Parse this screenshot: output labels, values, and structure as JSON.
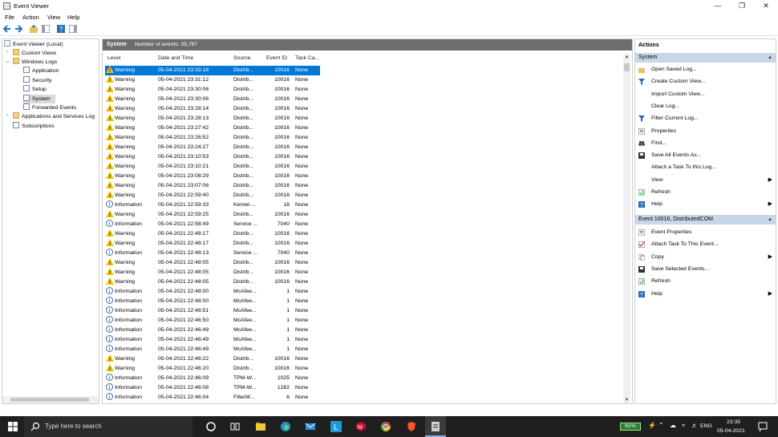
{
  "window": {
    "title": "Event Viewer"
  },
  "menu": [
    "File",
    "Action",
    "View",
    "Help"
  ],
  "tree": {
    "root": "Event Viewer (Local)",
    "custom_views": "Custom Views",
    "windows_logs": "Windows Logs",
    "logs": [
      "Application",
      "Security",
      "Setup",
      "System",
      "Forwarded Events"
    ],
    "apps_services": "Applications and Services Log",
    "subscriptions": "Subscriptions"
  },
  "center": {
    "header_title": "System",
    "header_count": "Number of events: 35,787",
    "columns": [
      "Level",
      "Date and Time",
      "Source",
      "Event ID",
      "Task Ca..."
    ],
    "rows": [
      {
        "level": "Warning",
        "date": "05-04-2021 23:33:18",
        "source": "Distrib...",
        "id": "10016",
        "task": "None",
        "selected": true
      },
      {
        "level": "Warning",
        "date": "05-04-2021 23:31:12",
        "source": "Distrib...",
        "id": "10016",
        "task": "None"
      },
      {
        "level": "Warning",
        "date": "05-04-2021 23:30:06",
        "source": "Distrib...",
        "id": "10016",
        "task": "None"
      },
      {
        "level": "Warning",
        "date": "05-04-2021 23:30:06",
        "source": "Distrib...",
        "id": "10016",
        "task": "None"
      },
      {
        "level": "Warning",
        "date": "05-04-2021 23:28:14",
        "source": "Distrib...",
        "id": "10016",
        "task": "None"
      },
      {
        "level": "Warning",
        "date": "05-04-2021 23:28:13",
        "source": "Distrib...",
        "id": "10016",
        "task": "None"
      },
      {
        "level": "Warning",
        "date": "05-04-2021 23:27:42",
        "source": "Distrib...",
        "id": "10016",
        "task": "None"
      },
      {
        "level": "Warning",
        "date": "05-04-2021 23:26:52",
        "source": "Distrib...",
        "id": "10016",
        "task": "None"
      },
      {
        "level": "Warning",
        "date": "05-04-2021 23:24:27",
        "source": "Distrib...",
        "id": "10016",
        "task": "None"
      },
      {
        "level": "Warning",
        "date": "05-04-2021 23:10:53",
        "source": "Distrib...",
        "id": "10016",
        "task": "None"
      },
      {
        "level": "Warning",
        "date": "05-04-2021 23:10:21",
        "source": "Distrib...",
        "id": "10016",
        "task": "None"
      },
      {
        "level": "Warning",
        "date": "05-04-2021 23:08:29",
        "source": "Distrib...",
        "id": "10016",
        "task": "None"
      },
      {
        "level": "Warning",
        "date": "05-04-2021 23:07:06",
        "source": "Distrib...",
        "id": "10016",
        "task": "None"
      },
      {
        "level": "Warning",
        "date": "05-04-2021 22:59:40",
        "source": "Distrib...",
        "id": "10016",
        "task": "None"
      },
      {
        "level": "Information",
        "date": "05-04-2021 22:59:33",
        "source": "Kernel-...",
        "id": "16",
        "task": "None"
      },
      {
        "level": "Warning",
        "date": "05-04-2021 22:59:25",
        "source": "Distrib...",
        "id": "10016",
        "task": "None"
      },
      {
        "level": "Information",
        "date": "05-04-2021 22:58:49",
        "source": "Service ...",
        "id": "7040",
        "task": "None"
      },
      {
        "level": "Warning",
        "date": "05-04-2021 22:48:17",
        "source": "Distrib...",
        "id": "10016",
        "task": "None"
      },
      {
        "level": "Warning",
        "date": "05-04-2021 22:48:17",
        "source": "Distrib...",
        "id": "10016",
        "task": "None"
      },
      {
        "level": "Information",
        "date": "05-04-2021 22:48:13",
        "source": "Service ...",
        "id": "7040",
        "task": "None"
      },
      {
        "level": "Warning",
        "date": "05-04-2021 22:48:05",
        "source": "Distrib...",
        "id": "10016",
        "task": "None"
      },
      {
        "level": "Warning",
        "date": "05-04-2021 22:48:05",
        "source": "Distrib...",
        "id": "10016",
        "task": "None"
      },
      {
        "level": "Warning",
        "date": "05-04-2021 22:48:05",
        "source": "Distrib...",
        "id": "10016",
        "task": "None"
      },
      {
        "level": "Information",
        "date": "05-04-2021 22:48:00",
        "source": "McAfee...",
        "id": "1",
        "task": "None"
      },
      {
        "level": "Information",
        "date": "05-04-2021 22:48:00",
        "source": "McAfee...",
        "id": "1",
        "task": "None"
      },
      {
        "level": "Information",
        "date": "05-04-2021 22:46:51",
        "source": "McAfee...",
        "id": "1",
        "task": "None"
      },
      {
        "level": "Information",
        "date": "05-04-2021 22:46:50",
        "source": "McAfee...",
        "id": "1",
        "task": "None"
      },
      {
        "level": "Information",
        "date": "05-04-2021 22:46:49",
        "source": "McAfee...",
        "id": "1",
        "task": "None"
      },
      {
        "level": "Information",
        "date": "05-04-2021 22:46:49",
        "source": "McAfee...",
        "id": "1",
        "task": "None"
      },
      {
        "level": "Information",
        "date": "05-04-2021 22:46:49",
        "source": "McAfee...",
        "id": "1",
        "task": "None"
      },
      {
        "level": "Warning",
        "date": "05-04-2021 22:46:22",
        "source": "Distrib...",
        "id": "10016",
        "task": "None"
      },
      {
        "level": "Warning",
        "date": "05-04-2021 22:46:20",
        "source": "Distrib...",
        "id": "10016",
        "task": "None"
      },
      {
        "level": "Information",
        "date": "05-04-2021 22:46:09",
        "source": "TPM-W...",
        "id": "1025",
        "task": "None"
      },
      {
        "level": "Information",
        "date": "05-04-2021 22:46:08",
        "source": "TPM-W...",
        "id": "1282",
        "task": "None"
      },
      {
        "level": "Information",
        "date": "05-04-2021 22:46:04",
        "source": "FilterM...",
        "id": "6",
        "task": "None"
      }
    ]
  },
  "actions": {
    "title": "Actions",
    "section1": "System",
    "items1": [
      {
        "label": "Open Saved Log...",
        "icon": "folder-open-icon",
        "arrow": false
      },
      {
        "label": "Create Custom View...",
        "icon": "filter-icon",
        "arrow": false
      },
      {
        "label": "Import Custom View...",
        "icon": "",
        "arrow": false
      },
      {
        "label": "Clear Log...",
        "icon": "",
        "arrow": false
      },
      {
        "label": "Filter Current Log...",
        "icon": "filter-icon",
        "arrow": false
      },
      {
        "label": "Properties",
        "icon": "properties-icon",
        "arrow": false
      },
      {
        "label": "Find...",
        "icon": "binoculars-icon",
        "arrow": false
      },
      {
        "label": "Save All Events As...",
        "icon": "save-icon",
        "arrow": false
      },
      {
        "label": "Attach a Task To this Log...",
        "icon": "",
        "arrow": false
      },
      {
        "label": "View",
        "icon": "",
        "arrow": true
      },
      {
        "label": "Refresh",
        "icon": "refresh-icon",
        "arrow": false
      },
      {
        "label": "Help",
        "icon": "help-icon",
        "arrow": true
      }
    ],
    "section2": "Event 10016, DistributedCOM",
    "items2": [
      {
        "label": "Event Properties",
        "icon": "properties-icon",
        "arrow": false
      },
      {
        "label": "Attach Task To This Event...",
        "icon": "task-icon",
        "arrow": false
      },
      {
        "label": "Copy",
        "icon": "copy-icon",
        "arrow": true
      },
      {
        "label": "Save Selected Events...",
        "icon": "save-icon",
        "arrow": false
      },
      {
        "label": "Refresh",
        "icon": "refresh-icon",
        "arrow": false
      },
      {
        "label": "Help",
        "icon": "help-icon",
        "arrow": true
      }
    ]
  },
  "taskbar": {
    "search_placeholder": "Type here to search",
    "battery": "61%",
    "lang": "ENG",
    "time": "23:35",
    "date": "05-04-2021"
  },
  "colors": {
    "selection": "#0078d7",
    "header": "#6d6d6d",
    "section": "#c7d7e8",
    "taskbar": "#1f1f1f"
  }
}
